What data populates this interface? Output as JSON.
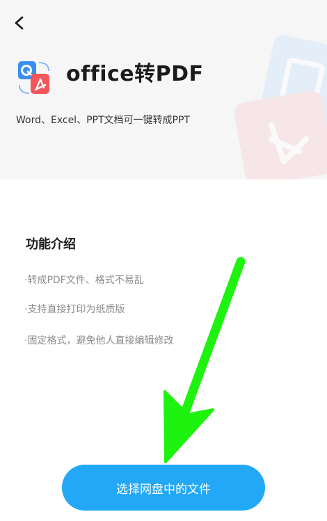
{
  "header": {
    "title": "office转PDF",
    "subtitle": "Word、Excel、PPT文档可一键转成PPT"
  },
  "intro": {
    "title": "功能介绍",
    "features": [
      "·转成PDF文件、格式不易乱",
      "·支持直接打印为纸质版",
      "·固定格式，避免他人直接编辑修改"
    ]
  },
  "action": {
    "button_label": "选择网盘中的文件"
  },
  "icons": {
    "back": "chevron-left-icon",
    "app": "office-to-pdf-icon",
    "decoration": "document-pdf-decoration",
    "annotation": "green-arrow-annotation"
  },
  "colors": {
    "accent": "#22a8f6",
    "pdf_red": "#f2555a",
    "office_blue": "#3a8ef0",
    "annotation_green": "#1ef20f",
    "header_bg": "#f6f6f7"
  }
}
